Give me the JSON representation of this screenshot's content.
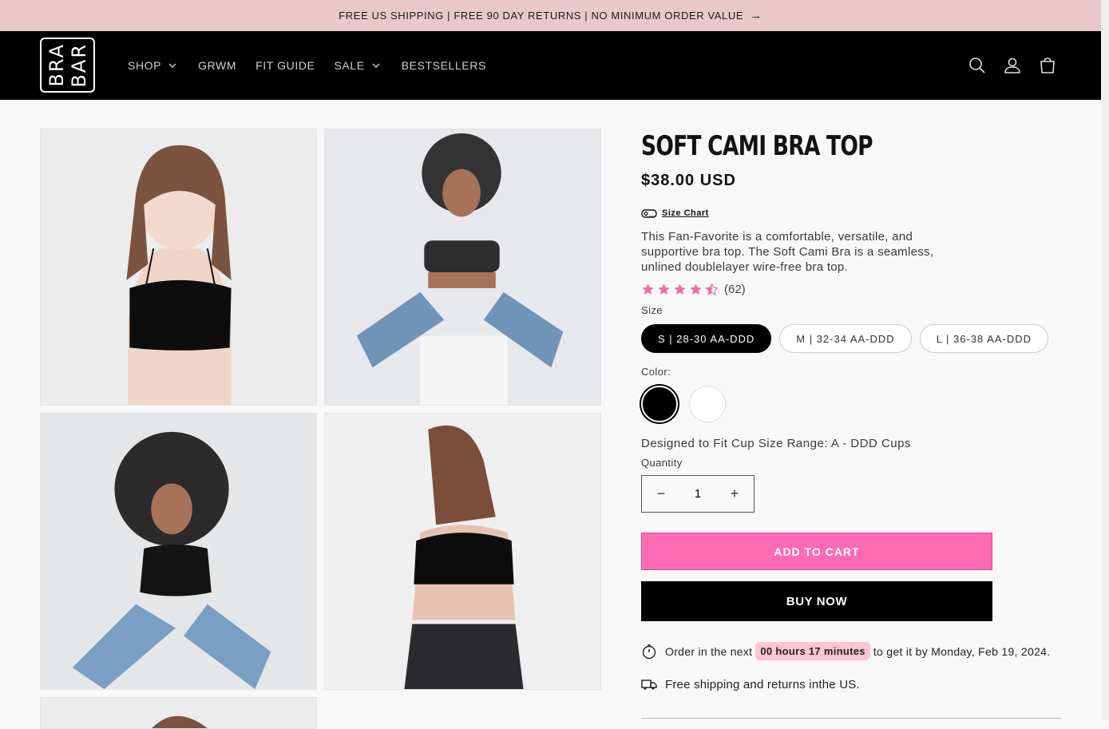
{
  "announcement": {
    "text": "FREE US SHIPPING | FREE 90 DAY RETURNS | NO MINIMUM ORDER VALUE",
    "arrow": "→"
  },
  "logo": {
    "line1": "BRA",
    "line2": "BAR"
  },
  "nav": [
    {
      "label": "SHOP",
      "has_dropdown": true
    },
    {
      "label": "GRWM",
      "has_dropdown": false
    },
    {
      "label": "FIT GUIDE",
      "has_dropdown": false
    },
    {
      "label": "SALE",
      "has_dropdown": true
    },
    {
      "label": "BESTSELLERS",
      "has_dropdown": false
    }
  ],
  "header_icons": [
    "search-icon",
    "account-icon",
    "cart-icon"
  ],
  "product": {
    "title": "SOFT CAMI BRA TOP",
    "price": "$38.00 USD",
    "size_chart_label": "Size Chart",
    "description": "This Fan-Favorite is a comfortable, versatile, and supportive bra top. The Soft Cami Bra is a seamless, unlined doublelayer wire-free bra top.",
    "rating": {
      "stars": 4.5,
      "count_text": "(62)"
    },
    "size_label": "Size",
    "sizes": [
      "S | 28-30 AA-DDD",
      "M | 32-34 AA-DDD",
      "L | 36-38 AA-DDD"
    ],
    "selected_size": "S | 28-30 AA-DDD",
    "color_label": "Color:",
    "colors": [
      "black",
      "white"
    ],
    "selected_color": "black",
    "fit_text": "Designed to Fit Cup Size Range: A - DDD Cups",
    "quantity_label": "Quantity",
    "quantity_value": "1",
    "minus": "−",
    "plus": "+",
    "add_to_cart": "ADD TO CART",
    "buy_now": "BUY NOW",
    "delivery": {
      "prefix": "Order in the next",
      "timer": "00 hours 17 minutes",
      "suffix": "to get it by Monday, Feb 19, 2024."
    },
    "shipping": "Free shipping and returns inthe US."
  },
  "colors": {
    "accent_pink": "#ff6ab5",
    "announcement_bg": "#e8c8cc",
    "timer_bg": "#ffc3d3",
    "star": "#f06aa8"
  }
}
